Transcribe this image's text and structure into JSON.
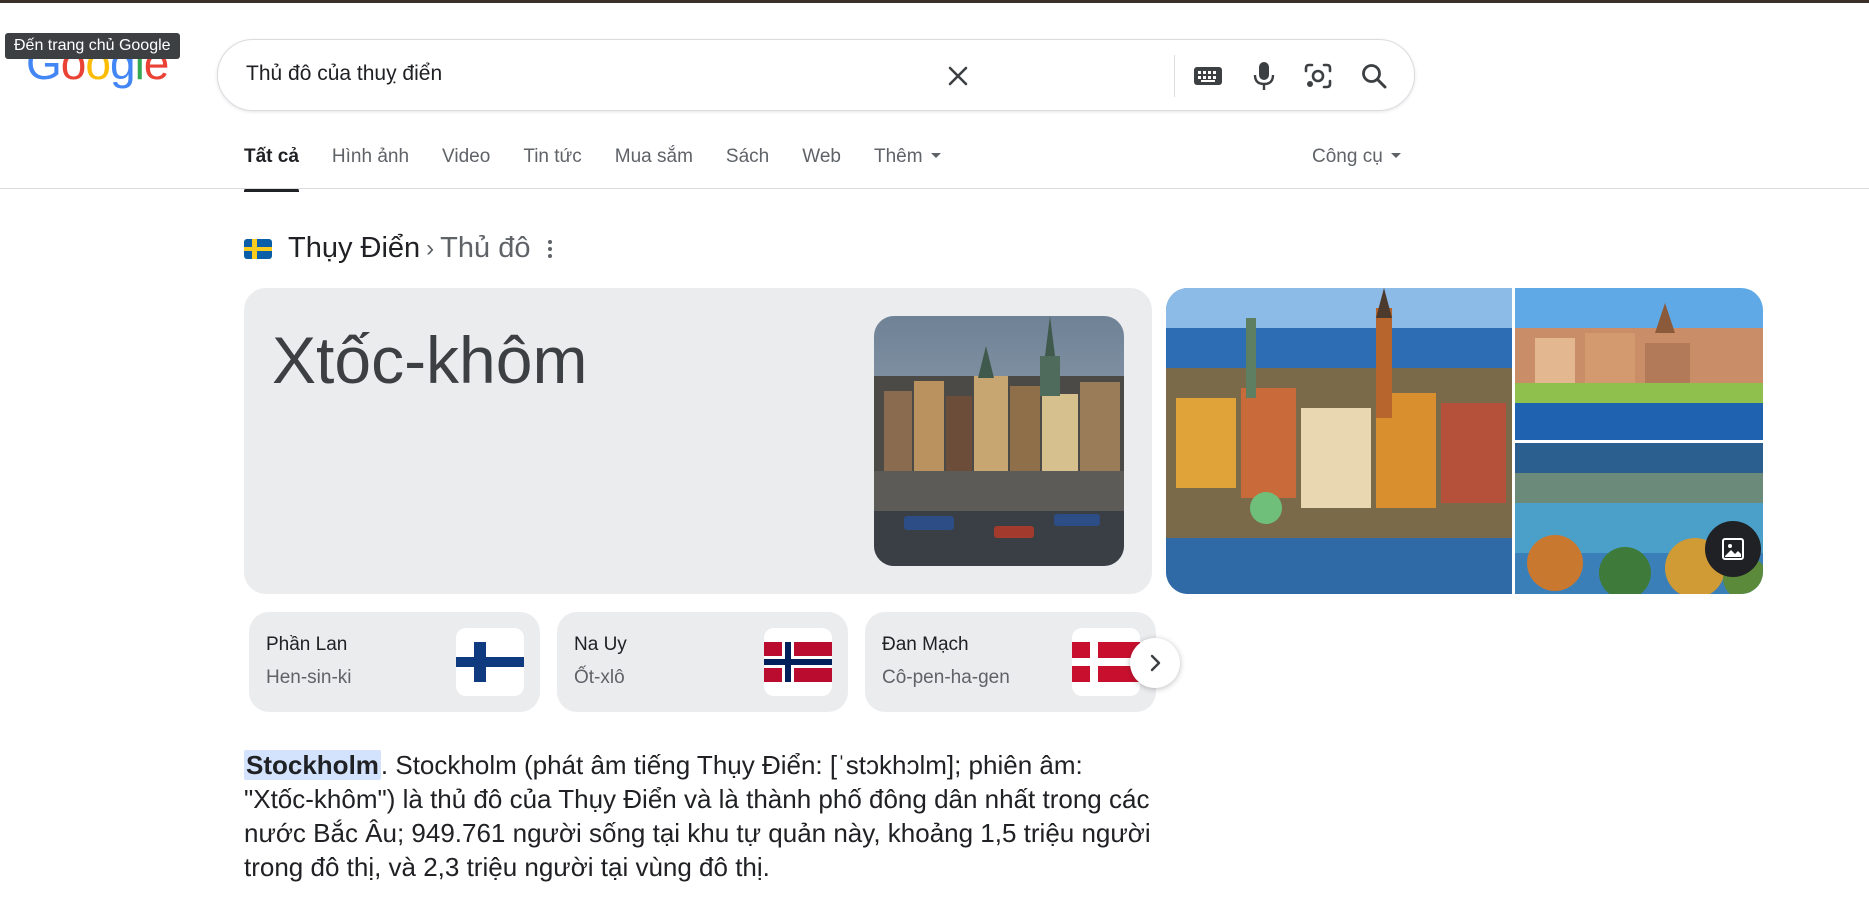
{
  "logo": {
    "text": "Google",
    "letters": [
      "G",
      "o",
      "o",
      "g",
      "l",
      "e"
    ],
    "colors": [
      "#4285F4",
      "#EA4335",
      "#FBBC05",
      "#4285F4",
      "#34A853",
      "#EA4335"
    ]
  },
  "tooltip": "Đến trang chủ Google",
  "search": {
    "query": "Thủ đô của thuỵ điển",
    "icons": [
      "clear-icon",
      "keyboard-icon",
      "microphone-icon",
      "lens-camera-icon",
      "search-icon"
    ]
  },
  "tabs": [
    {
      "label": "Tất cả",
      "active": true
    },
    {
      "label": "Hình ảnh",
      "active": false
    },
    {
      "label": "Video",
      "active": false
    },
    {
      "label": "Tin tức",
      "active": false
    },
    {
      "label": "Mua sắm",
      "active": false
    },
    {
      "label": "Sách",
      "active": false
    },
    {
      "label": "Web",
      "active": false
    },
    {
      "label": "Thêm",
      "active": false
    }
  ],
  "tools": "Công cụ",
  "breadcrumb": {
    "country": "Thụy Điển",
    "separator": "›",
    "attribute": "Thủ đô"
  },
  "answer": {
    "title": "Xtốc-khôm"
  },
  "related": [
    {
      "country": "Phần Lan",
      "capital": "Hen-sin-ki",
      "flag": "finland-flag"
    },
    {
      "country": "Na Uy",
      "capital": "Ốt-xlô",
      "flag": "norway-flag"
    },
    {
      "country": "Đan Mạch",
      "capital": "Cô-pen-ha-gen",
      "flag": "denmark-flag"
    }
  ],
  "snippet": {
    "highlight": "Stockholm",
    "rest": ". Stockholm (phát âm tiếng Thụy Điển: [ˈstɔkhɔlm]; phiên âm: \"Xtốc-khôm\") là thủ đô của Thụy Điển và là thành phố đông dân nhất trong các nước Bắc Âu; 949.761 người sống tại khu tự quản này, khoảng 1,5 triệu người trong đô thị, và 2,3 triệu người tại vùng đô thị."
  },
  "colors": {
    "accent_text": "#202124",
    "muted_text": "#5f6368",
    "card_bg": "#ebecee",
    "highlight_bg": "#d3e3fd"
  }
}
